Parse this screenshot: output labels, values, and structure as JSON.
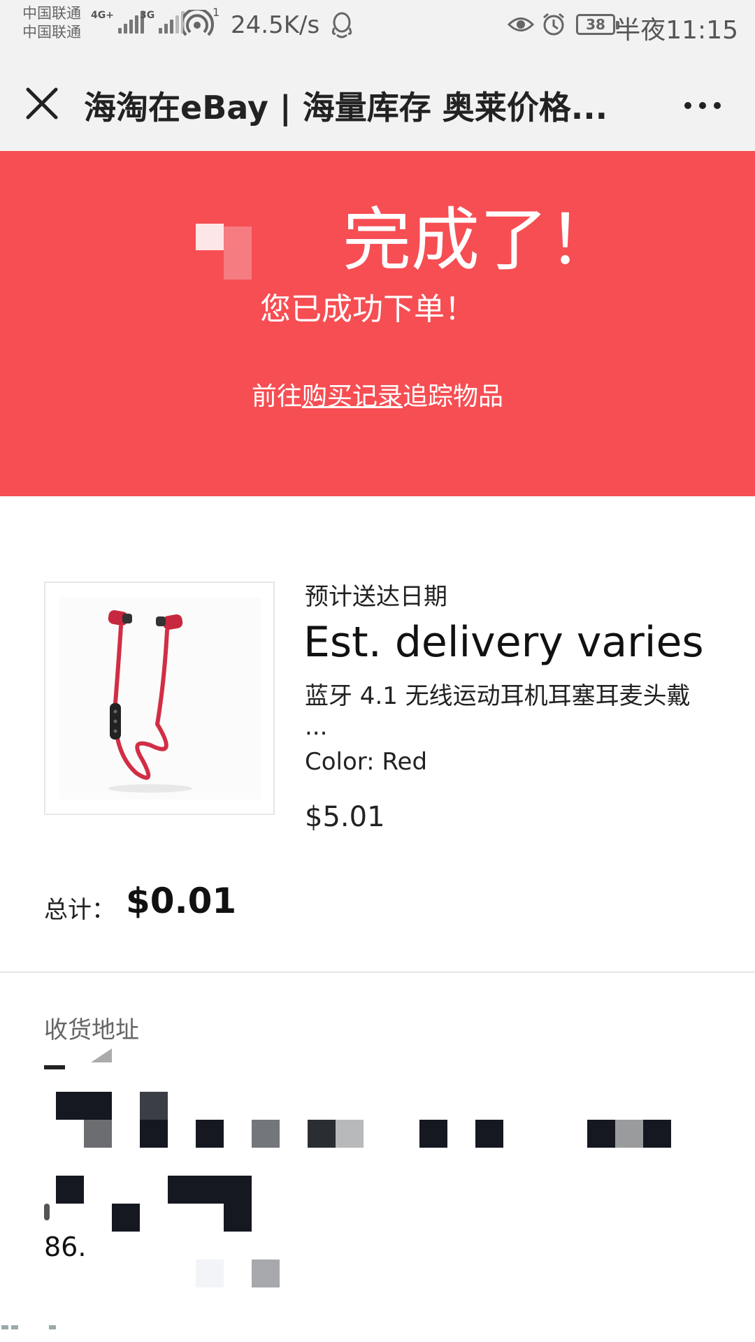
{
  "status_bar": {
    "carrier_1": "中国联通",
    "carrier_2": "中国联通",
    "net_1": "4G+",
    "net_2": "3G",
    "hotspot_count": "1",
    "net_speed": "24.5K/s",
    "battery": "38",
    "time": "半夜11:15"
  },
  "title_bar": {
    "title": "海淘在eBay | 海量库存 奥莱价格..."
  },
  "banner": {
    "headline": "完成了！",
    "subtitle": "您已成功下单！",
    "track_prefix": "前往",
    "track_link": "购买记录",
    "track_suffix": "追踪物品"
  },
  "item": {
    "delivery_label": "预计送达日期",
    "delivery_value": "Est. delivery varies",
    "title": "蓝牙 4.1 无线运动耳机耳塞耳麦头戴 ...",
    "color": "Color: Red",
    "price": "$5.01"
  },
  "total": {
    "label": "总计：",
    "value": "$0.01"
  },
  "address": {
    "heading": "收货地址",
    "phone_partial": "86."
  },
  "colors": {
    "banner": "#f64e53",
    "product": "#d12e45"
  }
}
